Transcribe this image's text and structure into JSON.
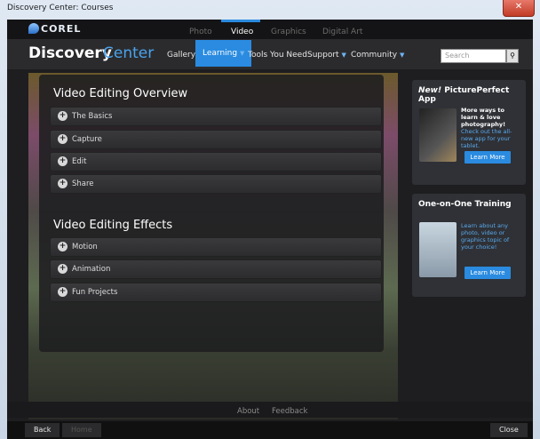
{
  "window": {
    "title": "Discovery Center: Courses",
    "close_icon": "close-icon"
  },
  "logo": {
    "text": "COREL"
  },
  "product_tabs": [
    {
      "label": "Photo"
    },
    {
      "label": "Video"
    },
    {
      "label": "Graphics"
    },
    {
      "label": "Digital Art"
    }
  ],
  "brand": {
    "part1": "Discovery",
    "part2": "Center"
  },
  "nav": [
    {
      "label": "Gallery"
    },
    {
      "label": "Learning"
    },
    {
      "label": "Tools You Need"
    },
    {
      "label": "Support"
    },
    {
      "label": "Community"
    }
  ],
  "search": {
    "placeholder": "Search"
  },
  "sections": [
    {
      "title": "Video Editing Overview",
      "items": [
        {
          "label": "The Basics"
        },
        {
          "label": "Capture"
        },
        {
          "label": "Edit"
        },
        {
          "label": "Share"
        }
      ]
    },
    {
      "title": "Video Editing Effects",
      "items": [
        {
          "label": "Motion"
        },
        {
          "label": "Animation"
        },
        {
          "label": "Fun Projects"
        }
      ]
    }
  ],
  "promo1": {
    "title_new": "New!",
    "title_rest": "PicturePerfect App",
    "text_white": "More ways to learn & love photography!",
    "text_blue": "Check out the all-new app for your tablet.",
    "button": "Learn More"
  },
  "promo2": {
    "title": "One-on-One Training",
    "text_blue": "Learn about any photo, video or graphics topic of your choice!",
    "button": "Learn More"
  },
  "footer": {
    "about": "About",
    "feedback": "Feedback"
  },
  "bottom": {
    "back": "Back",
    "home": "Home",
    "close": "Close"
  },
  "colors": {
    "accent": "#2a8be0",
    "brand_blue": "#4aa3ec"
  }
}
